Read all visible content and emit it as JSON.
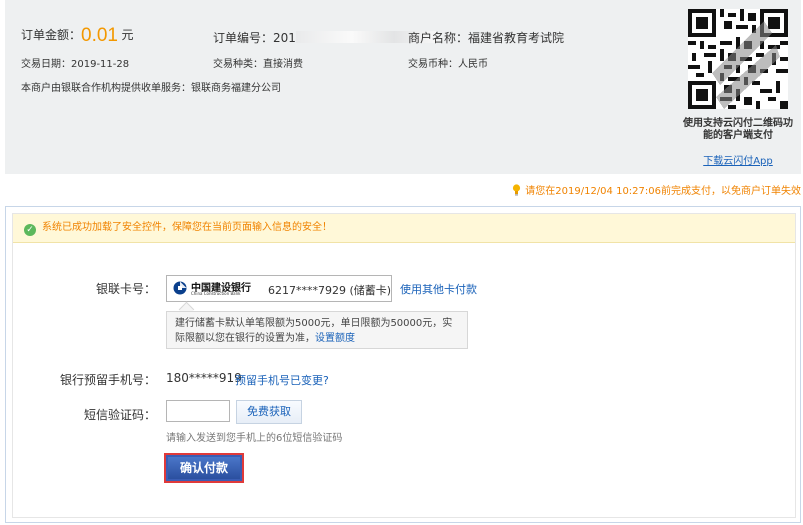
{
  "order": {
    "amount_label": "订单金额：",
    "amount_value": "0.01",
    "amount_unit": "元",
    "order_no_label": "订单编号：",
    "order_no_value": "201",
    "merchant_label": "商户名称：",
    "merchant_value": "福建省教育考试院",
    "date_label": "交易日期：",
    "date_value": "2019-11-28",
    "type_label": "交易种类：",
    "type_value": "直接消费",
    "currency_label": "交易币种：",
    "currency_value": "人民币",
    "service_text": "本商户由银联合作机构提供收单服务：银联商务福建分公司",
    "qr_caption": "使用支持云闪付二维码功能的客户端支付",
    "qr_link": "下载云闪付App"
  },
  "deadline": "请您在2019/12/04 10:27:06前完成支付，以免商户订单失效",
  "security_msg": "系统已成功加载了安全控件，保障您在当前页面输入信息的安全！",
  "form": {
    "card_label": "银联卡号：",
    "bank_name_cn": "中国建设银行",
    "bank_name_en": "China Construction Bank",
    "card_number": "6217****7929 (储蓄卡)",
    "other_card_link": "使用其他卡付款",
    "limit_tip": "建行储蓄卡默认单笔限额为5000元，单日限额为50000元，实际限额以您在银行的设置为准，",
    "limit_link": "设置额度",
    "phone_label": "银行预留手机号：",
    "phone_value": "180*****919",
    "phone_change_link": "预留手机号已变更?",
    "sms_label": "短信验证码：",
    "sms_input_value": "",
    "sms_button": "免费获取",
    "sms_hint": "请输入发送到您手机上的6位短信验证码",
    "confirm_button": "确认付款"
  },
  "colors": {
    "accent_orange": "#f39800",
    "link_blue": "#1a62b9",
    "primary_button": "#2b4f9f",
    "highlight_border": "#e03a3a"
  }
}
